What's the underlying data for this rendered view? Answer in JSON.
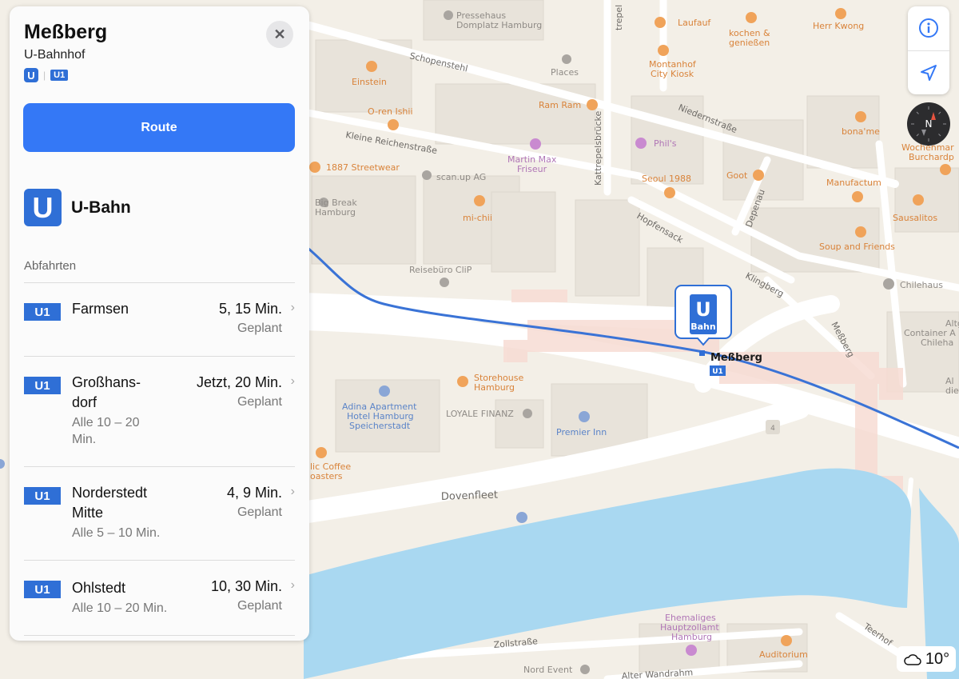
{
  "station": {
    "title": "Meßberg",
    "subtitle": "U-Bahnhof",
    "badge_u": "U",
    "badge_line": "U1",
    "close_glyph": "✕",
    "route_label": "Route"
  },
  "section": {
    "icon_letter": "U",
    "title": "U-Bahn",
    "departures_label": "Abfahrten"
  },
  "departures": [
    {
      "line": "U1",
      "dest": [
        "Farmsen"
      ],
      "freq": [],
      "times": "5, 15 Min.",
      "status": "Geplant"
    },
    {
      "line": "U1",
      "dest": [
        "Großhans-",
        "dorf"
      ],
      "freq": [
        "Alle 10 – 20",
        "Min."
      ],
      "times": "Jetzt, 20 Min.",
      "status": "Geplant"
    },
    {
      "line": "U1",
      "dest": [
        "Norderstedt",
        "Mitte"
      ],
      "freq": [
        "Alle 5 – 10 Min."
      ],
      "times": "4, 9 Min.",
      "status": "Geplant"
    },
    {
      "line": "U1",
      "dest": [
        "Ohlstedt"
      ],
      "freq": [
        "Alle 10 – 20 Min."
      ],
      "times": "10, 30 Min.",
      "status": "Geplant"
    }
  ],
  "map": {
    "station_marker_letter": "U",
    "station_marker_sub": "Bahn",
    "station_label": "Meßberg",
    "station_line_badge": "U1",
    "building_number": "4",
    "streets": {
      "schopenstehl": "Schopenstehl",
      "niedernstrasse": "Niedernstraße",
      "kleine_reichenstrasse": "Kleine Reichenstraße",
      "kattrepelsbruecke": "Kattrepelsbrücke",
      "hopfensack": "Hopfensack",
      "depenau": "Depenau",
      "klingberg": "Klingberg",
      "messberg_street": "Meßberg",
      "dovenfleet": "Dovenfleet",
      "zollstrasse": "Zollstraße",
      "teerhof": "Teerhof",
      "alter_wandrahm": "Alter Wandrahm",
      "trepel": "trepel"
    },
    "pois": {
      "pressehaus": [
        "Pressehaus",
        "Domplatz Hamburg"
      ],
      "laufauf": "Laufauf",
      "kochen": [
        "kochen &",
        "genießen"
      ],
      "herr_kwong": "Herr Kwong",
      "places": "Places",
      "einstein": "Einstein",
      "montanhof": [
        "Montanhof",
        "City Kiosk"
      ],
      "oren": "O-ren Ishii",
      "ramram": "Ram Ram",
      "martin": [
        "Martin Max",
        "Friseur"
      ],
      "bonaame": "bona'me",
      "wochenmarkt": [
        "Wochenmar",
        "Burchardp"
      ],
      "phils": "Phil's",
      "streetwear": "1887 Streetwear",
      "scanup": "scan.up AG",
      "seoul": "Seoul 1988",
      "goot": "Goot",
      "manufactum": "Manufactum",
      "bigbreak": [
        "Big Break",
        "Hamburg"
      ],
      "michii": "mi-chii",
      "sausalitos": "Sausalitos",
      "soup": "Soup and Friends",
      "reisebuero": "Reisebüro CliP",
      "chilehaus": "Chilehaus",
      "altg": [
        "Altg",
        "Container A",
        "Chileha"
      ],
      "storehouse": [
        "Storehouse",
        "Hamburg"
      ],
      "adina": [
        "Adina Apartment",
        "Hotel Hamburg",
        "Speicherstadt"
      ],
      "loyale": "LOYALE FINANZ",
      "premier": "Premier Inn",
      "coffee": [
        "lic Coffee",
        "oasters"
      ],
      "ehemaliges": [
        "Ehemaliges",
        "Hauptzollamt",
        "Hamburg"
      ],
      "auditorium": "Auditorium",
      "nordevent": "Nord Event",
      "alle": [
        "Al",
        "die"
      ]
    }
  },
  "weather": {
    "temperature": "10°",
    "icon": "cloud-icon"
  },
  "colors": {
    "accent": "#3478f6",
    "u_blue": "#2f6fd6",
    "water": "#a9d8f1",
    "poi_orange": "#d9833a"
  }
}
